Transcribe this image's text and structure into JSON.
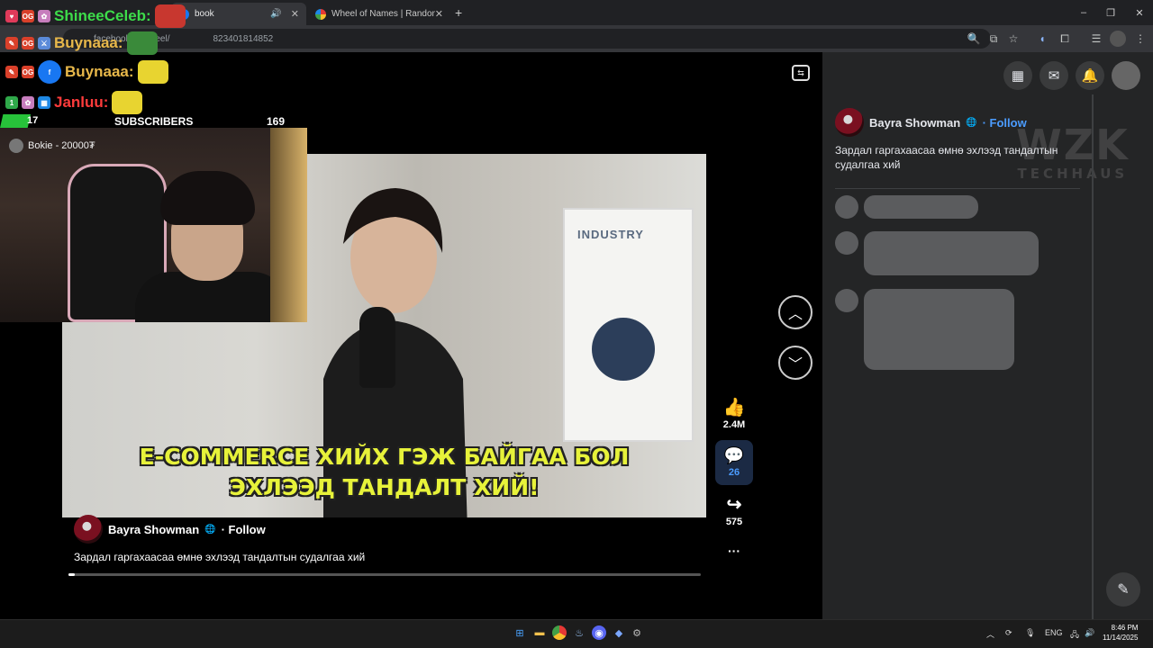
{
  "browser": {
    "tabs": [
      {
        "label": "book",
        "active": true
      },
      {
        "label": "Wheel of Names | Random nar",
        "active": false
      }
    ],
    "new_tab": "+",
    "url": "facebook.com/reel/",
    "url_suffix": "823401814852",
    "window_controls": [
      "–",
      "❐",
      "✕"
    ]
  },
  "stream_overlay": {
    "chat": [
      {
        "name": "ShineeCeleb:",
        "color": "#3ddc4a"
      },
      {
        "name": "Buynaaa:",
        "color": "#e8b84a"
      },
      {
        "name": "Buynaaa:",
        "color": "#e8b84a"
      },
      {
        "name": "Janluu:",
        "color": "#ff3b3b"
      }
    ],
    "subs_left": "17",
    "subs_label": "SUBSCRIBERS",
    "subs_right": "169",
    "subs_progress": 0.1,
    "webcam_tag": "Bokie - 20000₮"
  },
  "reel": {
    "caption_line1": "E-COMMERCE ХИЙХ ГЭЖ БАЙГАА БОЛ",
    "caption_line2": "ЭХЛЭЭД ТАНДАЛТ ХИЙ!",
    "video_banner": "INDUSTRY",
    "author": "Bayra Showman",
    "globe": "🌐",
    "follow": "· Follow",
    "description": "Зардал гаргахаасаа өмнө эхлээд тандалтын судалгаа хий",
    "progress": 0.01,
    "likes": "2.4M",
    "comments": "26",
    "shares": "575",
    "more": "···"
  },
  "panel": {
    "author": "Bayra Showman",
    "follow": "· Follow",
    "description": "Зардал гаргахаасаа өмнө эхлээд тандалтын судалгаа хий",
    "watermark_big": "WZK",
    "watermark_small": "TECHHAUS"
  },
  "taskbar": {
    "lang": "ENG",
    "time": "8:46 PM",
    "date": "11/14/2025"
  },
  "colors": {
    "accent": "#4b9cff",
    "caption": "#e7f23a",
    "panel_bg": "#242526"
  }
}
